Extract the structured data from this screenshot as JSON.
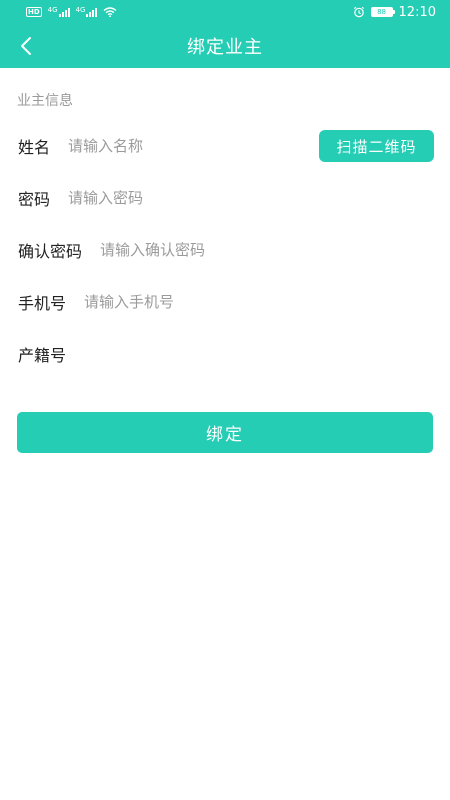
{
  "status_bar": {
    "hd_label": "HD",
    "net1": "4G",
    "net2": "4G",
    "battery": "88",
    "time": "12:10"
  },
  "header": {
    "title": "绑定业主",
    "back_icon": "chevron-left-icon"
  },
  "form": {
    "section_title": "业主信息",
    "name": {
      "label": "姓名",
      "placeholder": "请输入名称",
      "value": ""
    },
    "scan_button_label": "扫描二维码",
    "password": {
      "label": "密码",
      "placeholder": "请输入密码",
      "value": ""
    },
    "confirm_password": {
      "label": "确认密码",
      "placeholder": "请输入确认密码",
      "value": ""
    },
    "phone": {
      "label": "手机号",
      "placeholder": "请输入手机号",
      "value": ""
    },
    "property_no": {
      "label": "产籍号",
      "placeholder": "",
      "value": ""
    },
    "submit_label": "绑定"
  },
  "colors": {
    "accent": "#24cdb3",
    "label_text": "#222222",
    "placeholder_text": "#9b9b9b",
    "section_text": "#9a9a9a"
  }
}
